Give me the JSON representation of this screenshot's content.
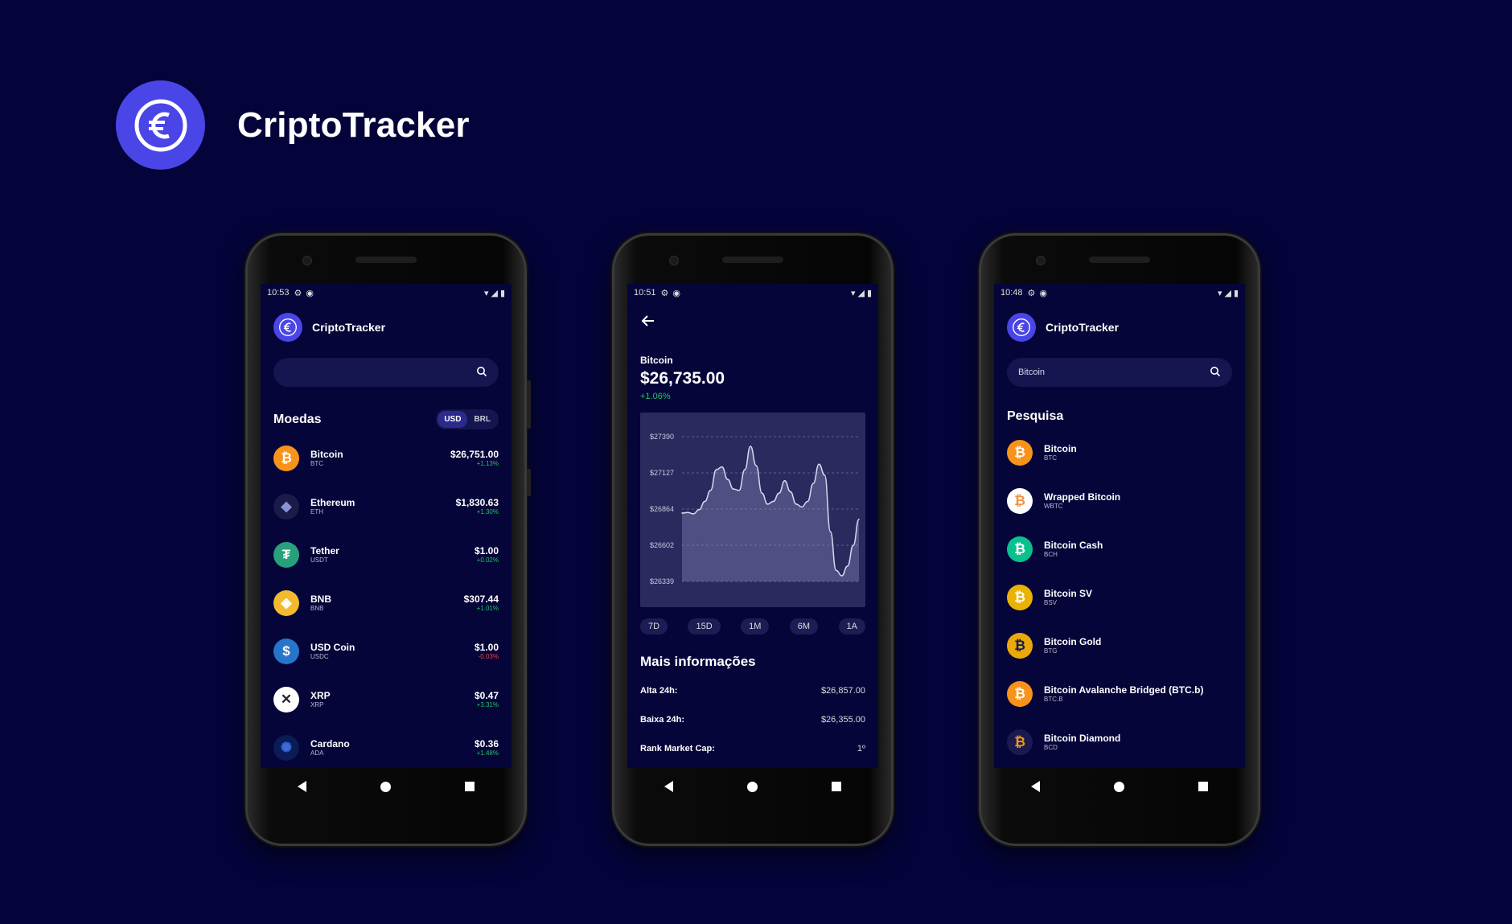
{
  "brand": {
    "title": "CriptoTracker"
  },
  "colors": {
    "background": "#04043a",
    "accent": "#4a45e6",
    "positive": "#22c55e",
    "negative": "#ef4444"
  },
  "phone1": {
    "status": {
      "time": "10:53"
    },
    "app_title": "CriptoTracker",
    "search": {
      "value": "",
      "placeholder": ""
    },
    "section_title": "Moedas",
    "currency_toggle": {
      "options": [
        "USD",
        "BRL"
      ],
      "selected": "USD"
    },
    "coins": [
      {
        "name": "Bitcoin",
        "symbol": "BTC",
        "price": "$26,751.00",
        "change": "+1.13%",
        "icon": "bitcoin-icon"
      },
      {
        "name": "Ethereum",
        "symbol": "ETH",
        "price": "$1,830.63",
        "change": "+1.30%",
        "icon": "ethereum-icon"
      },
      {
        "name": "Tether",
        "symbol": "USDT",
        "price": "$1.00",
        "change": "+0.02%",
        "icon": "tether-icon"
      },
      {
        "name": "BNB",
        "symbol": "BNB",
        "price": "$307.44",
        "change": "+1.01%",
        "icon": "bnb-icon"
      },
      {
        "name": "USD Coin",
        "symbol": "USDC",
        "price": "$1.00",
        "change": "-0.03%",
        "icon": "usd-coin-icon"
      },
      {
        "name": "XRP",
        "symbol": "XRP",
        "price": "$0.47",
        "change": "+3.31%",
        "icon": "xrp-icon"
      },
      {
        "name": "Cardano",
        "symbol": "ADA",
        "price": "$0.36",
        "change": "+1.48%",
        "icon": "cardano-icon"
      }
    ]
  },
  "phone2": {
    "status": {
      "time": "10:51"
    },
    "coin_name": "Bitcoin",
    "price": "$26,735.00",
    "change": "+1.06%",
    "chart_data": {
      "type": "area",
      "title": "",
      "xlabel": "",
      "ylabel": "",
      "y_ticks": [
        "$27390",
        "$27127",
        "$26864",
        "$26602",
        "$26339"
      ],
      "ylim": [
        26339,
        27390
      ],
      "grid": true,
      "values": [
        26835,
        26840,
        26830,
        26860,
        26920,
        27000,
        27150,
        27170,
        27080,
        27010,
        27000,
        27150,
        27320,
        27180,
        26980,
        26900,
        26920,
        26980,
        27070,
        26990,
        26900,
        26880,
        26920,
        27050,
        27190,
        27110,
        26700,
        26420,
        26380,
        26450,
        26600,
        26790
      ]
    },
    "periods": [
      "7D",
      "15D",
      "1M",
      "6M",
      "1A"
    ],
    "more_title": "Mais informações",
    "info": [
      {
        "label": "Alta 24h:",
        "value": "$26,857.00"
      },
      {
        "label": "Baixa 24h:",
        "value": "$26,355.00"
      },
      {
        "label": "Rank Market Cap:",
        "value": "1º"
      }
    ]
  },
  "phone3": {
    "status": {
      "time": "10:48"
    },
    "app_title": "CriptoTracker",
    "search": {
      "value": "Bitcoin"
    },
    "section_title": "Pesquisa",
    "results": [
      {
        "name": "Bitcoin",
        "symbol": "BTC",
        "icon": "bitcoin-icon"
      },
      {
        "name": "Wrapped Bitcoin",
        "symbol": "WBTC",
        "icon": "wrapped-bitcoin-icon"
      },
      {
        "name": "Bitcoin Cash",
        "symbol": "BCH",
        "icon": "bitcoin-cash-icon"
      },
      {
        "name": "Bitcoin SV",
        "symbol": "BSV",
        "icon": "bitcoin-sv-icon"
      },
      {
        "name": "Bitcoin Gold",
        "symbol": "BTG",
        "icon": "bitcoin-gold-icon"
      },
      {
        "name": "Bitcoin Avalanche Bridged (BTC.b)",
        "symbol": "BTC.B",
        "icon": "bitcoin-avalanche-icon"
      },
      {
        "name": "Bitcoin Diamond",
        "symbol": "BCD",
        "icon": "bitcoin-diamond-icon"
      }
    ]
  }
}
